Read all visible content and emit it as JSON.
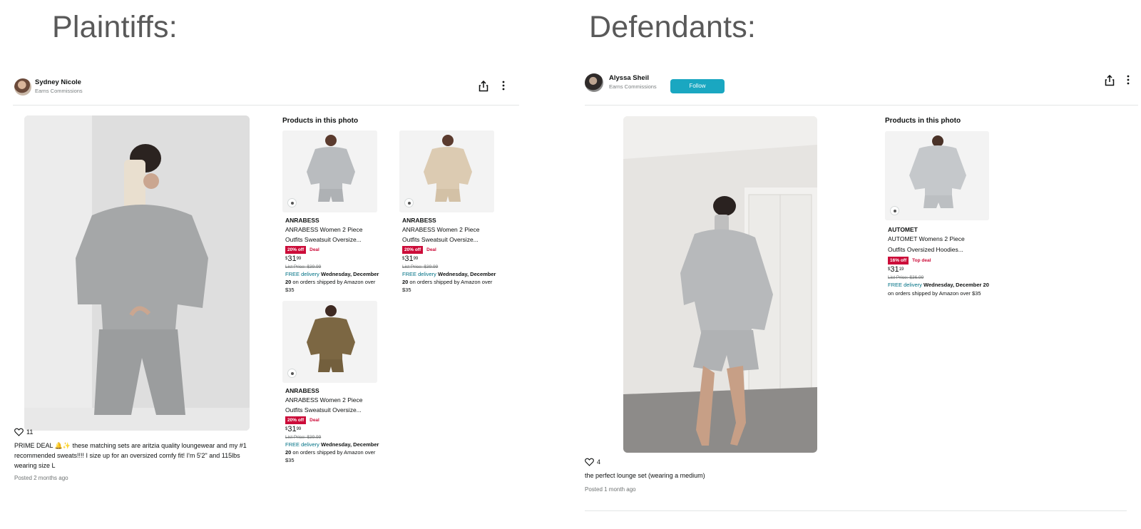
{
  "sections": {
    "left_title": "Plaintiffs:",
    "right_title": "Defendants:"
  },
  "left_post": {
    "author": "Sydney Nicole",
    "author_sub": "Earns Commissions",
    "products_heading": "Products in this photo",
    "products": [
      {
        "brand": "ANRABESS",
        "name_line1": "ANRABESS Women 2 Piece",
        "name_line2": "Outfits Sweatsuit Oversize...",
        "discount": "20% off",
        "deal": "Deal",
        "price_dollar": "$",
        "price_whole": "31",
        "price_cents": "99",
        "list_price": "List Price: $39.99",
        "free_delivery": "FREE delivery",
        "delivery_date": "Wednesday, December 20",
        "delivery_rest": " on orders shipped by Amazon over $35",
        "color": "#b9bcbf"
      },
      {
        "brand": "ANRABESS",
        "name_line1": "ANRABESS Women 2 Piece",
        "name_line2": "Outfits Sweatsuit Oversize...",
        "discount": "20% off",
        "deal": "Deal",
        "price_dollar": "$",
        "price_whole": "31",
        "price_cents": "99",
        "list_price": "List Price: $39.99",
        "free_delivery": "FREE delivery",
        "delivery_date": "Wednesday, December 20",
        "delivery_rest": " on orders shipped by Amazon over $35",
        "color": "#dccbb2"
      },
      {
        "brand": "ANRABESS",
        "name_line1": "ANRABESS Women 2 Piece",
        "name_line2": "Outfits Sweatsuit Oversize...",
        "discount": "20% off",
        "deal": "Deal",
        "price_dollar": "$",
        "price_whole": "31",
        "price_cents": "99",
        "list_price": "List Price: $39.99",
        "free_delivery": "FREE delivery",
        "delivery_date": "Wednesday, December 20",
        "delivery_rest": " on orders shipped by Amazon over $35",
        "color": "#7c6743"
      }
    ],
    "likes": "11",
    "caption": "PRIME DEAL 🔔✨ these matching sets are aritzia quality loungewear and my #1 recommended sweats!!!! I size up for an oversized comfy fit! I'm 5'2\" and 115lbs wearing size L",
    "posted": "Posted 2 months ago"
  },
  "right_post": {
    "author": "Alyssa Sheil",
    "author_sub": "Earns Commissions",
    "follow_label": "Follow",
    "products_heading": "Products in this photo",
    "products": [
      {
        "brand": "AUTOMET",
        "name_line1": "AUTOMET Womens 2 Piece",
        "name_line2": "Outfits Oversized Hoodies...",
        "discount": "16% off",
        "deal": "Top deal",
        "price_dollar": "$",
        "price_whole": "31",
        "price_cents": "19",
        "list_price": "List Price: $36.99",
        "free_delivery": "FREE delivery",
        "delivery_date": "Wednesday, December 20",
        "delivery_rest": " on orders shipped by Amazon over $35",
        "color": "#c5c8cb"
      }
    ],
    "likes": "4",
    "caption": "the perfect lounge set (wearing a medium)",
    "posted": "Posted 1 month ago"
  },
  "colors": {
    "deal_red": "#cc0c39",
    "follow_teal": "#1aa7c1",
    "link_teal": "#007185"
  },
  "icons": [
    "share-icon",
    "more-options-icon",
    "heart-icon",
    "eye-icon"
  ]
}
